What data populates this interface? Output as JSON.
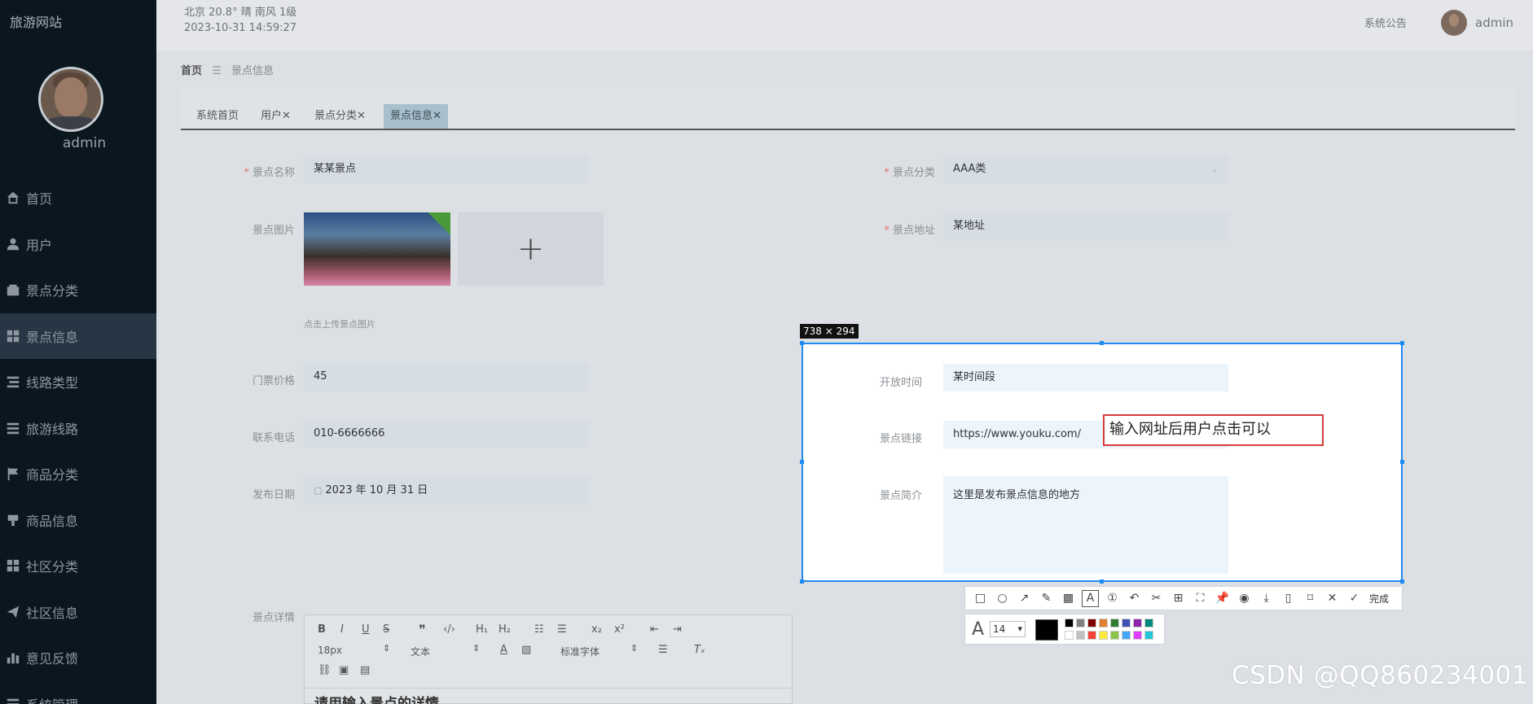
{
  "brand": "旅游网站",
  "sidebar": {
    "username": "admin",
    "items": [
      {
        "label": "首页",
        "icon": "home-icon"
      },
      {
        "label": "用户",
        "icon": "user-icon"
      },
      {
        "label": "景点分类",
        "icon": "wallet-icon"
      },
      {
        "label": "景点信息",
        "icon": "grid-icon"
      },
      {
        "label": "线路类型",
        "icon": "list-icon"
      },
      {
        "label": "旅游线路",
        "icon": "lines-icon"
      },
      {
        "label": "商品分类",
        "icon": "flag-icon"
      },
      {
        "label": "商品信息",
        "icon": "gavel-icon"
      },
      {
        "label": "社区分类",
        "icon": "grid-icon"
      },
      {
        "label": "社区信息",
        "icon": "send-icon"
      },
      {
        "label": "意见反馈",
        "icon": "bar-chart-icon"
      },
      {
        "label": "系统管理",
        "icon": "lines-icon"
      }
    ]
  },
  "header": {
    "weather": "北京  20.8°  晴  南风  1级",
    "datetime": "2023-10-31 14:59:27",
    "notice": "系统公告",
    "user": "admin"
  },
  "breadcrumb": {
    "home": "首页",
    "current": "景点信息"
  },
  "tabs": [
    {
      "label": "系统首页"
    },
    {
      "label": "用户✕"
    },
    {
      "label": "景点分类✕"
    },
    {
      "label": "景点信息✕"
    }
  ],
  "form": {
    "name_label": "景点名称",
    "name_value": "某某景点",
    "category_label": "景点分类",
    "category_value": "AAA类",
    "image_label": "景点图片",
    "address_label": "景点地址",
    "address_value": "某地址",
    "upload_hint": "点击上传景点图片",
    "price_label": "门票价格",
    "price_value": "45",
    "phone_label": "联系电话",
    "phone_value": "010-6666666",
    "date_label": "发布日期",
    "date_value": "2023 年 10 月 31 日",
    "open_label": "开放时间",
    "open_value": "某时间段",
    "link_label": "景点链接",
    "link_value": "https://www.youku.com/",
    "intro_label": "景点简介",
    "intro_value": "这里是发布景点信息的地方",
    "detail_label": "景点详情"
  },
  "editor": {
    "font_size": "18px",
    "format": "文本",
    "font": "标准字体",
    "placeholder_text": "请用输入景点的详情"
  },
  "snapshot": {
    "size": "738 × 294",
    "annotation": "输入网址后用户点击可以",
    "done_label": "完成",
    "font_size": "14"
  },
  "watermark": "CSDN @QQ860234001"
}
